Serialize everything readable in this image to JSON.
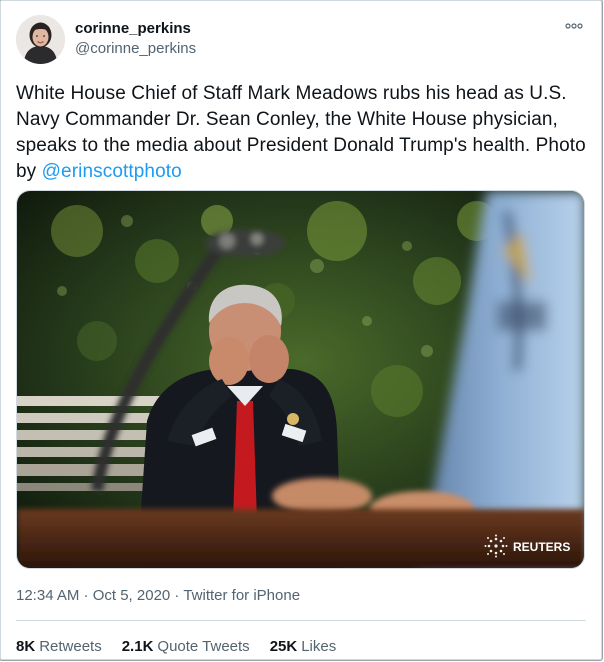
{
  "author": {
    "display_name": "corinne_perkins",
    "handle": "@corinne_perkins",
    "avatar_icon": "profile-photo-avatar"
  },
  "tweet": {
    "text_main": "White House Chief of Staff Mark Meadows rubs his head as U.S. Navy Commander Dr. Sean Conley, the White House physician, speaks to the media about President Donald Trump's health. Photo by ",
    "mention": "@erinscottphoto"
  },
  "media": {
    "watermark": "REUTERS"
  },
  "meta": {
    "timestamp": "12:34 AM · Oct 5, 2020 · ",
    "source": "Twitter for iPhone"
  },
  "stats": {
    "retweets_count": "8K",
    "retweets_label": "Retweets",
    "quotes_count": "2.1K",
    "quotes_label": "Quote Tweets",
    "likes_count": "25K",
    "likes_label": "Likes"
  },
  "colors": {
    "link": "#1d9bf0",
    "secondary_text": "#536471"
  }
}
